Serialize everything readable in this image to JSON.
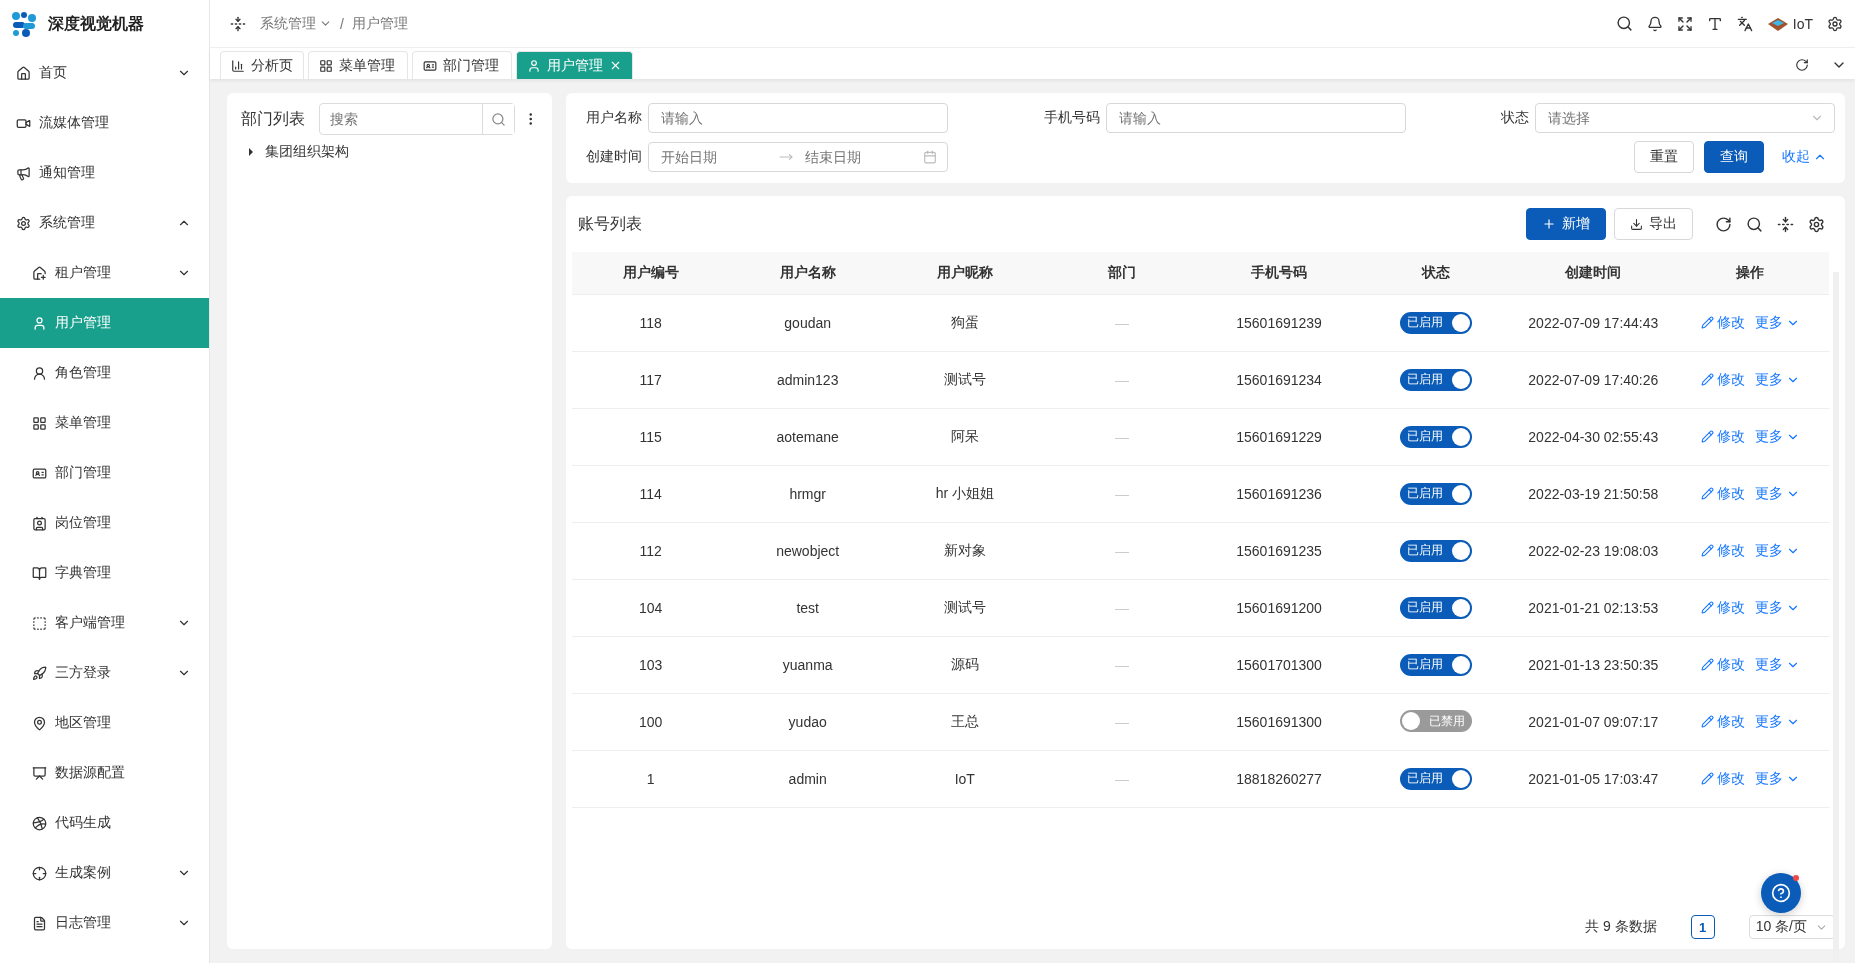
{
  "brand": {
    "name": "深度视觉机器"
  },
  "breadcrumb_separator": "/",
  "breadcrumb": [
    {
      "label": "系统管理",
      "dropdown": true
    },
    {
      "label": "用户管理",
      "dropdown": false
    }
  ],
  "header": {
    "user": "IoT"
  },
  "tabs": [
    {
      "label": "分析页",
      "selected": false
    },
    {
      "label": "菜单管理",
      "selected": false
    },
    {
      "label": "部门管理",
      "selected": false
    },
    {
      "label": "用户管理",
      "selected": true
    }
  ],
  "sidebar": {
    "items": [
      {
        "label": "首页",
        "selected": false,
        "expanded": false
      },
      {
        "label": "流媒体管理",
        "selected": false
      },
      {
        "label": "通知管理",
        "selected": false
      },
      {
        "label": "系统管理",
        "selected": false,
        "expanded": true,
        "children": [
          {
            "label": "租户管理",
            "selected": false,
            "expanded": false
          },
          {
            "label": "用户管理",
            "selected": true
          },
          {
            "label": "角色管理",
            "selected": false
          },
          {
            "label": "菜单管理",
            "selected": false
          },
          {
            "label": "部门管理",
            "selected": false
          },
          {
            "label": "岗位管理",
            "selected": false
          },
          {
            "label": "字典管理",
            "selected": false
          },
          {
            "label": "客户端管理",
            "selected": false,
            "expanded": false
          },
          {
            "label": "三方登录",
            "selected": false,
            "expanded": false
          },
          {
            "label": "地区管理",
            "selected": false
          },
          {
            "label": "数据源配置",
            "selected": false
          },
          {
            "label": "代码生成",
            "selected": false
          },
          {
            "label": "生成案例",
            "selected": false,
            "expanded": false
          },
          {
            "label": "日志管理",
            "selected": false,
            "expanded": false
          }
        ]
      }
    ]
  },
  "dept_panel": {
    "title": "部门列表",
    "search": {
      "placeholder": "搜索"
    },
    "tree": [
      {
        "label": "集团组织架构",
        "expanded": false
      }
    ]
  },
  "filters": {
    "fields": [
      {
        "label": "用户名称",
        "kind": "input",
        "placeholder": "请输入"
      },
      {
        "label": "手机号码",
        "kind": "input",
        "placeholder": "请输入"
      },
      {
        "label": "状态",
        "kind": "select",
        "placeholder": "请选择"
      },
      {
        "label": "创建时间",
        "kind": "daterange",
        "start_placeholder": "开始日期",
        "end_placeholder": "结束日期"
      }
    ],
    "buttons": {
      "reset": "重置",
      "query": "查询",
      "collapse": "收起"
    }
  },
  "table": {
    "title": "账号列表",
    "add_button": "新增",
    "export_button": "导出",
    "columns": [
      "用户编号",
      "用户名称",
      "用户昵称",
      "部门",
      "手机号码",
      "状态",
      "创建时间",
      "操作"
    ],
    "rows": [
      {
        "id": "118",
        "username": "goudan",
        "nickname": "狗蛋",
        "dept": "—",
        "phone": "15601691239",
        "status": {
          "label": "已启用",
          "on": true
        },
        "created": "2022-07-09 17:44:43",
        "actions": [
          "修改",
          "更多"
        ]
      },
      {
        "id": "117",
        "username": "admin123",
        "nickname": "测试号",
        "dept": "—",
        "phone": "15601691234",
        "status": {
          "label": "已启用",
          "on": true
        },
        "created": "2022-07-09 17:40:26",
        "actions": [
          "修改",
          "更多"
        ]
      },
      {
        "id": "115",
        "username": "aotemane",
        "nickname": "阿呆",
        "dept": "—",
        "phone": "15601691229",
        "status": {
          "label": "已启用",
          "on": true
        },
        "created": "2022-04-30 02:55:43",
        "actions": [
          "修改",
          "更多"
        ]
      },
      {
        "id": "114",
        "username": "hrmgr",
        "nickname": "hr 小姐姐",
        "dept": "—",
        "phone": "15601691236",
        "status": {
          "label": "已启用",
          "on": true
        },
        "created": "2022-03-19 21:50:58",
        "actions": [
          "修改",
          "更多"
        ]
      },
      {
        "id": "112",
        "username": "newobject",
        "nickname": "新对象",
        "dept": "—",
        "phone": "15601691235",
        "status": {
          "label": "已启用",
          "on": true
        },
        "created": "2022-02-23 19:08:03",
        "actions": [
          "修改",
          "更多"
        ]
      },
      {
        "id": "104",
        "username": "test",
        "nickname": "测试号",
        "dept": "—",
        "phone": "15601691200",
        "status": {
          "label": "已启用",
          "on": true
        },
        "created": "2021-01-21 02:13:53",
        "actions": [
          "修改",
          "更多"
        ]
      },
      {
        "id": "103",
        "username": "yuanma",
        "nickname": "源码",
        "dept": "—",
        "phone": "15601701300",
        "status": {
          "label": "已启用",
          "on": true
        },
        "created": "2021-01-13 23:50:35",
        "actions": [
          "修改",
          "更多"
        ]
      },
      {
        "id": "100",
        "username": "yudao",
        "nickname": "王总",
        "dept": "—",
        "phone": "15601691300",
        "status": {
          "label": "已禁用",
          "on": false
        },
        "created": "2021-01-07 09:07:17",
        "actions": [
          "修改",
          "更多"
        ]
      },
      {
        "id": "1",
        "username": "admin",
        "nickname": "IoT",
        "dept": "—",
        "phone": "18818260277",
        "status": {
          "label": "已启用",
          "on": true
        },
        "created": "2021-01-05 17:03:47",
        "actions": [
          "修改",
          "更多"
        ]
      }
    ]
  },
  "pagination": {
    "total": "共 9 条数据",
    "pages": [
      {
        "label": "1",
        "selected": true
      }
    ],
    "page_size": "10 条/页"
  }
}
